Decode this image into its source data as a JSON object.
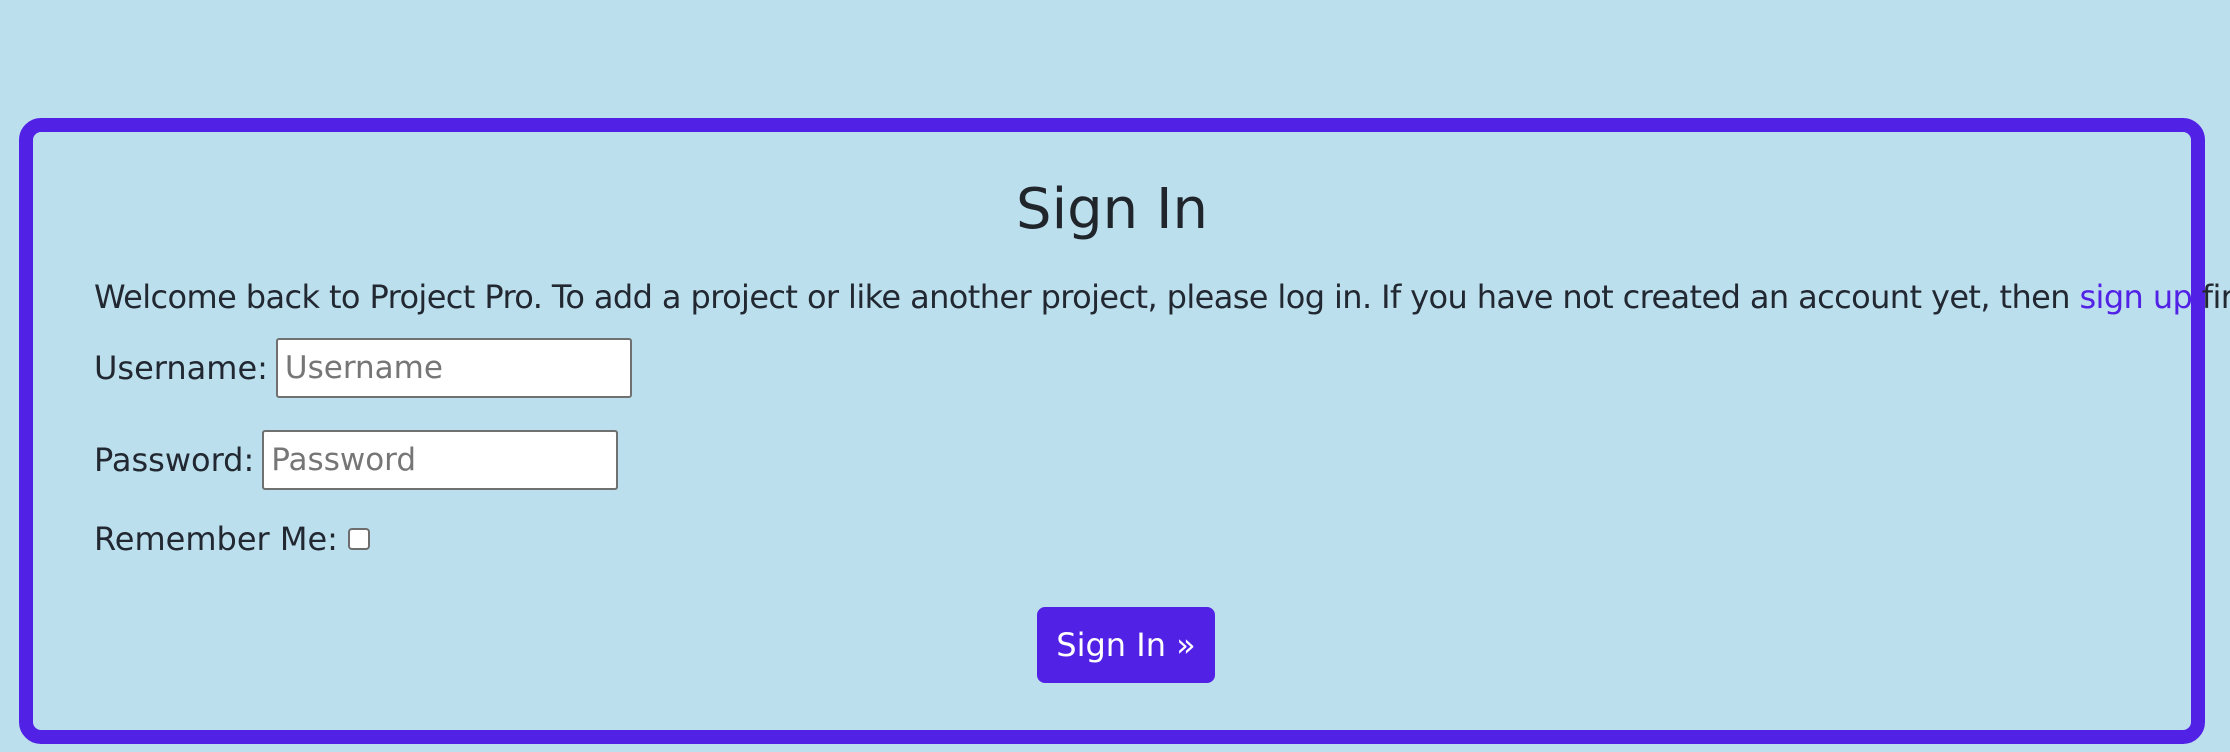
{
  "colors": {
    "page_background": "#bcdfed",
    "accent": "#5221e6",
    "text": "#222831",
    "button_text": "#ffffff"
  },
  "signin": {
    "title": "Sign In",
    "intro_before_link": "Welcome back to Project Pro. To add a project or like another project, please log in. If you have not created an account yet, then ",
    "signup_link_text": "sign up",
    "intro_after_link": " first.",
    "username": {
      "label": "Username:",
      "placeholder": "Username",
      "value": ""
    },
    "password": {
      "label": "Password:",
      "placeholder": "Password",
      "value": ""
    },
    "remember": {
      "label": "Remember Me:",
      "checked": false
    },
    "submit_label": "Sign In »"
  }
}
